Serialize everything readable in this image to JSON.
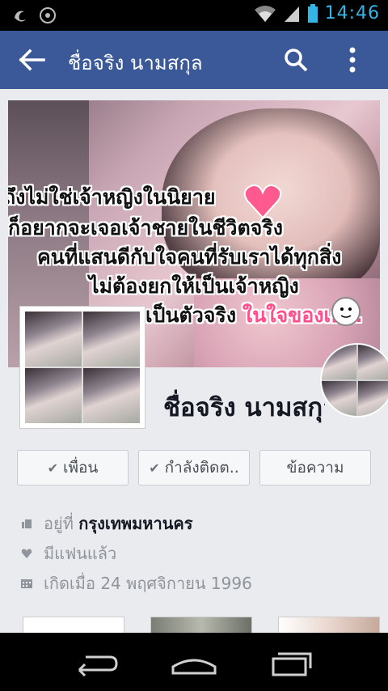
{
  "status_bar": {
    "time": "14:46",
    "accent_color": "#33b5e5",
    "icons": [
      "dark-mode-icon",
      "disc-icon",
      "wifi-icon",
      "signal-icon",
      "battery-icon"
    ]
  },
  "app_bar": {
    "title": "ชื่อจริง นามสกุล",
    "color": "#3b5998",
    "icons": [
      "back-arrow-icon",
      "search-icon",
      "more-vertical-icon"
    ]
  },
  "cover": {
    "lines": [
      "ถึงไม่ใช่เจ้าหญิงในนิยาย",
      "ก็อยากจะเจอเจ้าชายในชีวิตจริง",
      "คนที่แสนดีกับใจคนที่รับเราได้ทุกสิ่ง",
      "ไม่ต้องยกให้เป็นเจ้าหญิง"
    ],
    "last_line_black": "เป็นตัวจริง",
    "last_line_pink": "ในใจของเธอ."
  },
  "profile": {
    "name": "ชื่อจริง นามสกุล"
  },
  "buttons": {
    "friends": "เพื่อน",
    "following": "กำลังติดต..",
    "message": "ข้อความ"
  },
  "info": {
    "lives_prefix": "อยู่ที่",
    "lives_city": "กรุงเทพมหานคร",
    "relationship": "มีแฟนแล้ว",
    "birthday": "เกิดเมื่อ 24 พฤศจิกายน 1996"
  },
  "nav_bar": {
    "icons": [
      "back-icon",
      "home-icon",
      "recents-icon"
    ]
  }
}
